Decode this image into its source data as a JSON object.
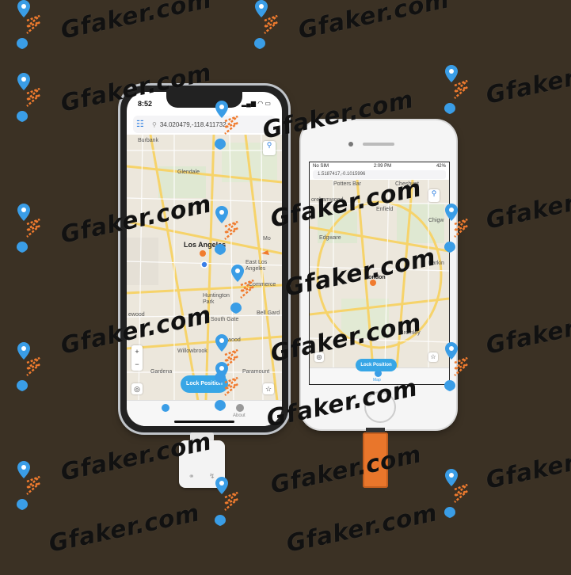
{
  "watermark": "Gfaker.com",
  "phone1": {
    "time": "8:52",
    "search_coords": "34.020479,-118.411732",
    "map_labels": {
      "burbank": "Burbank",
      "glendale": "Glendale",
      "los_angeles": "Los Angeles",
      "east_los_angeles": "East Los\nAngeles",
      "commerce": "Commerce",
      "huntington_park": "Huntington\nPark",
      "south_gate": "South Gate",
      "lynwood": "Lynwood",
      "willowbrook": "Willowbrook",
      "gardena": "Gardena",
      "paramount": "Paramount",
      "bell_gardens": "Bell Gard",
      "inglewood": "ewood",
      "mo": "Mo"
    },
    "lock_button": "Lock Position",
    "zoom_in": "+",
    "zoom_out": "−",
    "tab_about": "About"
  },
  "phone2": {
    "carrier": "No SIM",
    "time": "2:09 PM",
    "battery": "42%",
    "search_coords": "1.5187417,-0.1015996",
    "map_labels": {
      "potters_bar": "Potters Bar",
      "cheshunt": "Cheshunt",
      "borehamwood": "orehamwood",
      "enfield": "Enfield",
      "chigwell": "Chigw",
      "edgware": "Edgware",
      "london": "London",
      "barking": "Barkin",
      "bromley": "Bromley"
    },
    "lock_button": "Lock Position",
    "tab_map": "Map"
  }
}
